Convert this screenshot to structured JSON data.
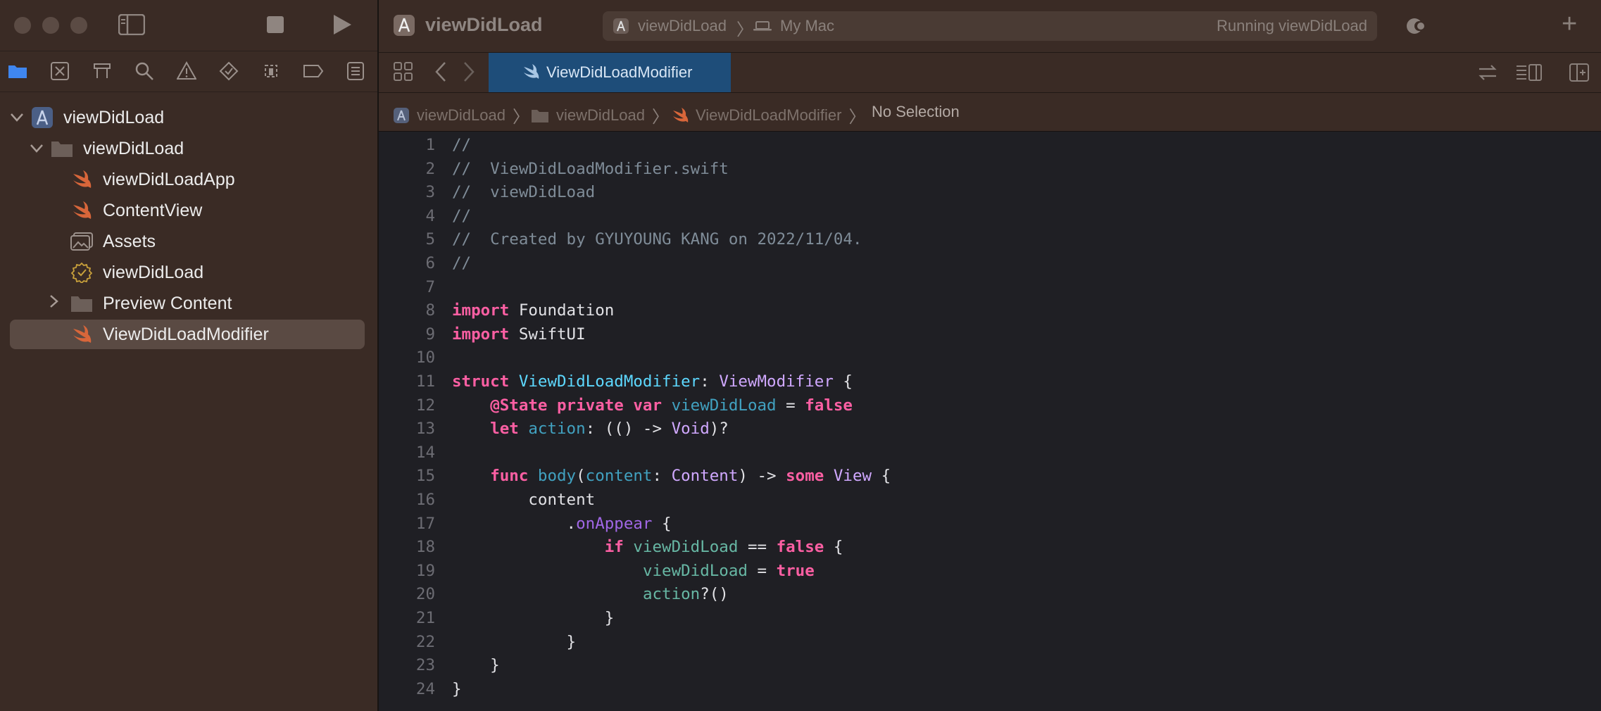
{
  "window": {
    "project_title": "viewDidLoad",
    "scheme": "viewDidLoad",
    "destination": "My Mac",
    "status": "Running viewDidLoad"
  },
  "sidebar": {
    "tree": [
      {
        "label": "viewDidLoad",
        "icon": "project-icon",
        "depth": 0,
        "chevron": "expanded"
      },
      {
        "label": "viewDidLoad",
        "icon": "folder-icon",
        "depth": 1,
        "chevron": "expanded"
      },
      {
        "label": "viewDidLoadApp",
        "icon": "swift-file-icon",
        "depth": 2,
        "chevron": "none"
      },
      {
        "label": "ContentView",
        "icon": "swift-file-icon",
        "depth": 2,
        "chevron": "none"
      },
      {
        "label": "Assets",
        "icon": "asset-catalog-icon",
        "depth": 2,
        "chevron": "none"
      },
      {
        "label": "viewDidLoad",
        "icon": "entitlements-icon",
        "depth": 2,
        "chevron": "none"
      },
      {
        "label": "Preview Content",
        "icon": "folder-icon",
        "depth": 2,
        "chevron": "collapsed"
      },
      {
        "label": "ViewDidLoadModifier",
        "icon": "swift-file-icon",
        "depth": 2,
        "chevron": "none",
        "selected": true
      }
    ]
  },
  "editor": {
    "tab_label": "ViewDidLoadModifier",
    "breadcrumb": [
      "viewDidLoad",
      "viewDidLoad",
      "ViewDidLoadModifier",
      "No Selection"
    ],
    "line_numbers": [
      "1",
      "2",
      "3",
      "4",
      "5",
      "6",
      "7",
      "8",
      "9",
      "10",
      "11",
      "12",
      "13",
      "14",
      "15",
      "16",
      "17",
      "18",
      "19",
      "20",
      "21",
      "22",
      "23",
      "24"
    ],
    "lines": [
      [
        [
          "cm",
          "//"
        ]
      ],
      [
        [
          "cm",
          "//  ViewDidLoadModifier.swift"
        ]
      ],
      [
        [
          "cm",
          "//  viewDidLoad"
        ]
      ],
      [
        [
          "cm",
          "//"
        ]
      ],
      [
        [
          "cm",
          "//  Created by GYUYOUNG KANG on 2022/11/04."
        ]
      ],
      [
        [
          "cm",
          "//"
        ]
      ],
      [],
      [
        [
          "kw",
          "import"
        ],
        [
          "pl",
          " Foundation"
        ]
      ],
      [
        [
          "kw",
          "import"
        ],
        [
          "pl",
          " SwiftUI"
        ]
      ],
      [],
      [
        [
          "kw",
          "struct"
        ],
        [
          "pl",
          " "
        ],
        [
          "tydecl",
          "ViewDidLoadModifier"
        ],
        [
          "pl",
          ": "
        ],
        [
          "ty",
          "ViewModifier"
        ],
        [
          "pl",
          " {"
        ]
      ],
      [
        [
          "pl",
          "    "
        ],
        [
          "kw",
          "@State"
        ],
        [
          "pl",
          " "
        ],
        [
          "kw",
          "private"
        ],
        [
          "pl",
          " "
        ],
        [
          "kw",
          "var"
        ],
        [
          "pl",
          " "
        ],
        [
          "prop",
          "viewDidLoad"
        ],
        [
          "pl",
          " = "
        ],
        [
          "lit",
          "false"
        ]
      ],
      [
        [
          "pl",
          "    "
        ],
        [
          "kw",
          "let"
        ],
        [
          "pl",
          " "
        ],
        [
          "prop",
          "action"
        ],
        [
          "pl",
          ": (() -> "
        ],
        [
          "ty",
          "Void"
        ],
        [
          "pl",
          ")?"
        ]
      ],
      [],
      [
        [
          "pl",
          "    "
        ],
        [
          "kw",
          "func"
        ],
        [
          "pl",
          " "
        ],
        [
          "prop",
          "body"
        ],
        [
          "pl",
          "("
        ],
        [
          "prop",
          "content"
        ],
        [
          "pl",
          ": "
        ],
        [
          "ty",
          "Content"
        ],
        [
          "pl",
          ") -> "
        ],
        [
          "kw",
          "some"
        ],
        [
          "pl",
          " "
        ],
        [
          "ty",
          "View"
        ],
        [
          "pl",
          " {"
        ]
      ],
      [
        [
          "pl",
          "        content"
        ]
      ],
      [
        [
          "pl",
          "            ."
        ],
        [
          "meth",
          "onAppear"
        ],
        [
          "pl",
          " {"
        ]
      ],
      [
        [
          "pl",
          "                "
        ],
        [
          "kw",
          "if"
        ],
        [
          "pl",
          " "
        ],
        [
          "var",
          "viewDidLoad"
        ],
        [
          "pl",
          " == "
        ],
        [
          "lit",
          "false"
        ],
        [
          "pl",
          " {"
        ]
      ],
      [
        [
          "pl",
          "                    "
        ],
        [
          "var",
          "viewDidLoad"
        ],
        [
          "pl",
          " = "
        ],
        [
          "lit",
          "true"
        ]
      ],
      [
        [
          "pl",
          "                    "
        ],
        [
          "var",
          "action"
        ],
        [
          "pl",
          "?()"
        ]
      ],
      [
        [
          "pl",
          "                }"
        ]
      ],
      [
        [
          "pl",
          "            }"
        ]
      ],
      [
        [
          "pl",
          "    }"
        ]
      ],
      [
        [
          "pl",
          "}"
        ]
      ]
    ]
  },
  "colors": {
    "accent": "#3f86f0",
    "sidebar_bg": "#3a2b25",
    "editor_bg": "#1f1f24",
    "tab_active": "#1e4d79"
  }
}
